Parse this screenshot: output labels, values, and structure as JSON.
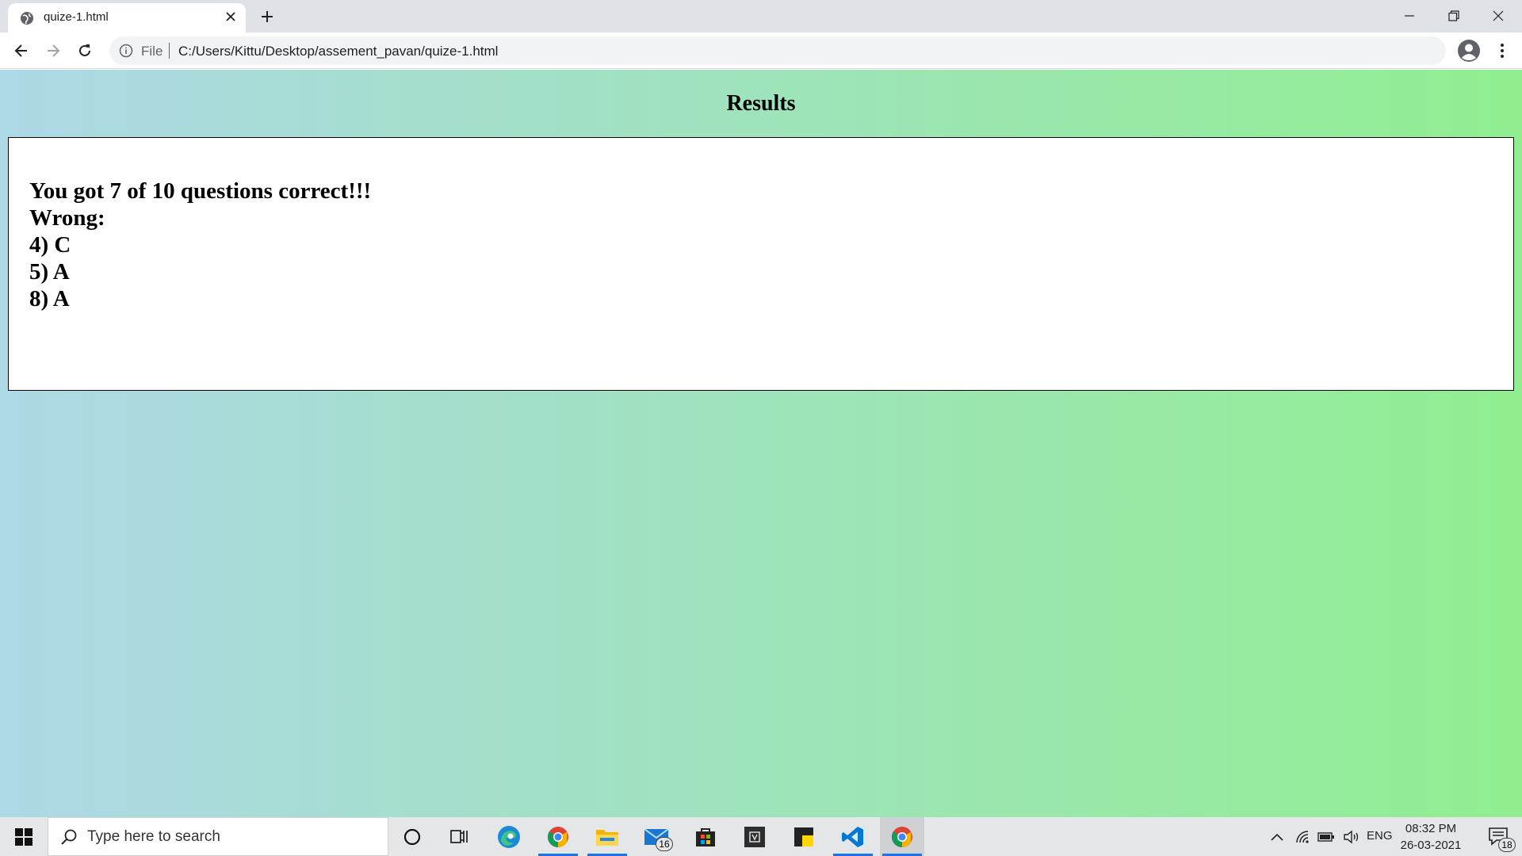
{
  "browser": {
    "tab_title": "quize-1.html",
    "omnibox_scheme": "File",
    "url": "C:/Users/Kittu/Desktop/assement_pavan/quize-1.html"
  },
  "page": {
    "heading": "Results",
    "score_line": "You got 7 of 10 questions correct!!!",
    "wrong_label": "Wrong:",
    "wrong_answers": [
      "4) C",
      "5) A",
      "8) A"
    ],
    "gradient_from": "#add8e6",
    "gradient_to": "#90ee90"
  },
  "taskbar": {
    "search_placeholder": "Type here to search",
    "pinned_icons": [
      "cortana-icon",
      "task-view-icon",
      "edge-icon",
      "chrome-icon",
      "file-explorer-icon",
      "mail-icon",
      "store-icon",
      "app-icon",
      "sticky-notes-icon",
      "vscode-icon",
      "chrome-active-icon"
    ],
    "mail_badge": "16",
    "language": "ENG",
    "time": "08:32 PM",
    "date": "26-03-2021",
    "notification_count": "18"
  }
}
